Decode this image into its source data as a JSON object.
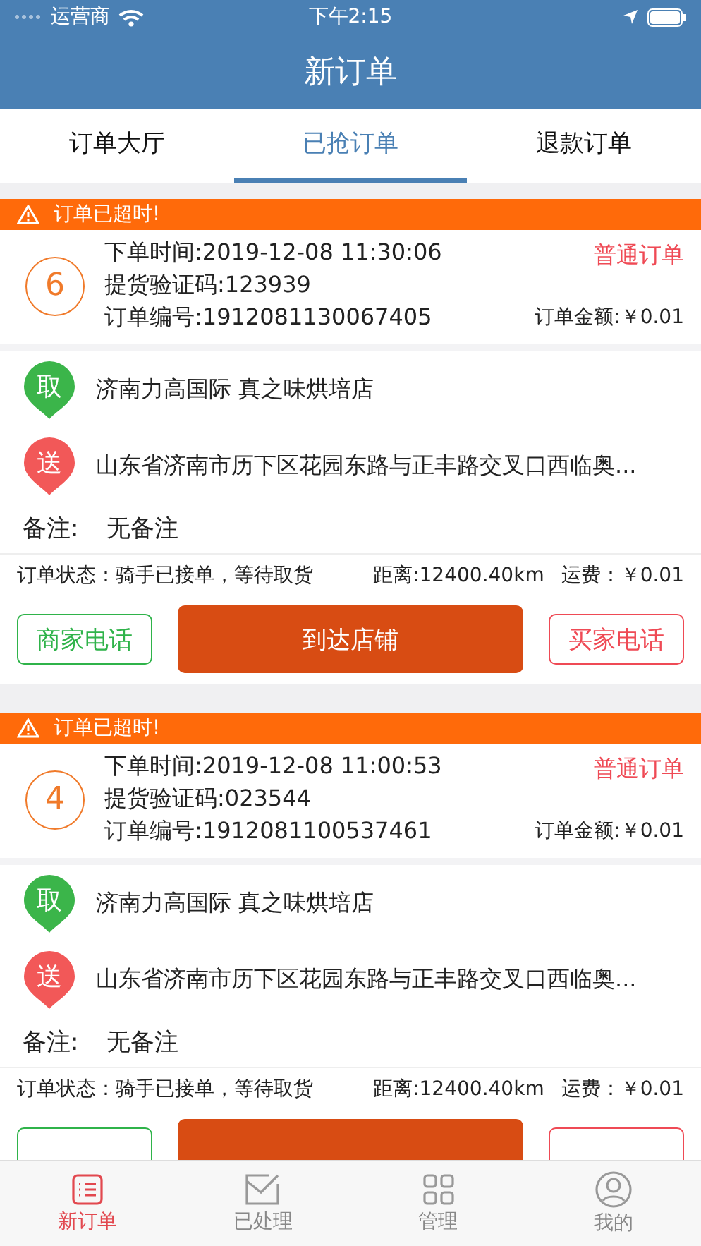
{
  "status_bar": {
    "carrier": "运营商",
    "time": "下午2:15"
  },
  "header": {
    "title": "新订单"
  },
  "tabs": [
    {
      "label": "订单大厅",
      "selected": false
    },
    {
      "label": "已抢订单",
      "selected": true
    },
    {
      "label": "退款订单",
      "selected": false
    }
  ],
  "orders": [
    {
      "alert": "订单已超时!",
      "number": "6",
      "order_time": "下单时间:2019-12-08 11:30:06",
      "code": "提货验证码:123939",
      "order_no": "订单编号:1912081130067405",
      "type": "普通订单",
      "amount": "订单金额:￥0.01",
      "stops": [
        {
          "kind": "pickup",
          "badge": "取",
          "address": "济南力高国际  真之味烘培店"
        },
        {
          "kind": "delivery",
          "badge": "送",
          "address": "山东省济南市历下区花园东路与正丰路交叉口西临奥..."
        }
      ],
      "remark_label": "备注:",
      "remark": "无备注",
      "status": "订单状态：骑手已接单，等待取货",
      "distance": "距离:12400.40km",
      "fee": "运费：￥0.01",
      "buttons": [
        {
          "kind": "merchant",
          "label": "商家电话"
        },
        {
          "kind": "primary",
          "label": "到达店铺"
        },
        {
          "kind": "buyer",
          "label": "买家电话"
        }
      ]
    },
    {
      "alert": "订单已超时!",
      "number": "4",
      "order_time": "下单时间:2019-12-08 11:00:53",
      "code": "提货验证码:023544",
      "order_no": "订单编号:1912081100537461",
      "type": "普通订单",
      "amount": "订单金额:￥0.01",
      "stops": [
        {
          "kind": "pickup",
          "badge": "取",
          "address": "济南力高国际  真之味烘培店"
        },
        {
          "kind": "delivery",
          "badge": "送",
          "address": "山东省济南市历下区花园东路与正丰路交叉口西临奥..."
        }
      ],
      "remark_label": "备注:",
      "remark": "无备注",
      "status": "订单状态：骑手已接单，等待取货",
      "distance": "距离:12400.40km",
      "fee": "运费：￥0.01",
      "buttons": [
        {
          "kind": "merchant"
        },
        {
          "kind": "primary"
        },
        {
          "kind": "buyer"
        }
      ]
    }
  ],
  "tab_bar": [
    {
      "kind": "list",
      "label": "新订单",
      "selected": true
    },
    {
      "kind": "mail",
      "label": "已处理",
      "selected": false
    },
    {
      "kind": "grid",
      "label": "管理",
      "selected": false
    },
    {
      "kind": "user",
      "label": "我的",
      "selected": false
    }
  ]
}
